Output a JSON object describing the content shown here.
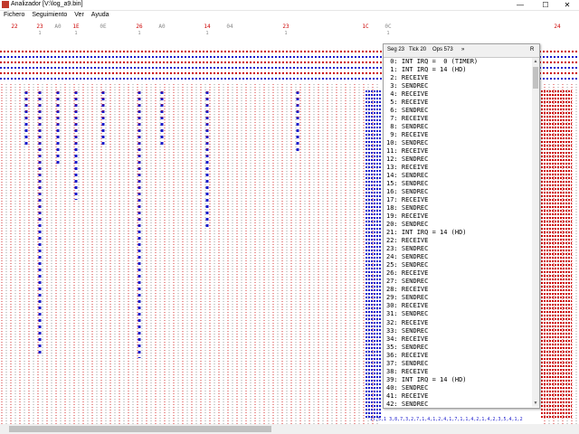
{
  "window": {
    "title": "Analizador [V:\\log_a9.bin]",
    "minimize": "—",
    "maximize": "☐",
    "close": "✕"
  },
  "menu": [
    {
      "label": "Fichero"
    },
    {
      "label": "Seguimiento"
    },
    {
      "label": "Ver"
    },
    {
      "label": "Ayuda"
    }
  ],
  "trace": {
    "top_labels": [
      {
        "text": "22",
        "color": "#cc0000"
      },
      {
        "text": "23",
        "color": "#cc0000"
      },
      {
        "text": "A0",
        "color": "#888888"
      },
      {
        "text": "1E",
        "color": "#cc0000"
      },
      {
        "text": "0E",
        "color": "#888888"
      },
      {
        "text": "26",
        "color": "#cc0000"
      },
      {
        "text": "A0",
        "color": "#888888"
      },
      {
        "text": "14",
        "color": "#cc0000"
      },
      {
        "text": "04",
        "color": "#888888"
      },
      {
        "text": "23",
        "color": "#cc0000"
      },
      {
        "text": "1C",
        "color": "#cc0000"
      },
      {
        "text": "0C",
        "color": "#888888"
      },
      {
        "text": "24",
        "color": "#cc0000"
      }
    ],
    "colors": {
      "red": "#cc0000",
      "blue": "#1a1acc",
      "gray": "#888888"
    }
  },
  "panel": {
    "tabs": [
      "Seg 23",
      "Tick 20",
      "Ops 573",
      "»",
      "R"
    ],
    "rows": [
      " 0: INT IRQ =  0 (TIMER)",
      " 1: INT IRQ = 14 (HD)",
      " 2: RECEIVE",
      " 3: SENDREC",
      " 4: RECEIVE",
      " 5: RECEIVE",
      " 6: SENDREC",
      " 7: RECEIVE",
      " 8: SENDREC",
      " 9: RECEIVE",
      "10: SENDREC",
      "11: RECEIVE",
      "12: SENDREC",
      "13: RECEIVE",
      "14: SENDREC",
      "15: SENDREC",
      "16: SENDREC",
      "17: RECEIVE",
      "18: SENDREC",
      "19: RECEIVE",
      "20: SENDREC",
      "21: INT IRQ = 14 (HD)",
      "22: RECEIVE",
      "23: SENDREC",
      "24: SENDREC",
      "25: SENDREC",
      "26: RECEIVE",
      "27: SENDREC",
      "28: RECEIVE",
      "29: SENDREC",
      "30: RECEIVE",
      "31: SENDREC",
      "32: RECEIVE",
      "33: SENDREC",
      "34: RECEIVE",
      "35: SENDREC",
      "36: RECEIVE",
      "37: SENDREC",
      "38: RECEIVE",
      "39: INT IRQ = 14 (HD)",
      "40: SENDREC",
      "41: RECEIVE",
      "42: SENDREC"
    ]
  },
  "bottom_numbers": "17,5,1  3,8,7,3,2,7,1,4,1,2,4,1,7,1,1,4,2,1,4,2,3,5,4,1,2"
}
